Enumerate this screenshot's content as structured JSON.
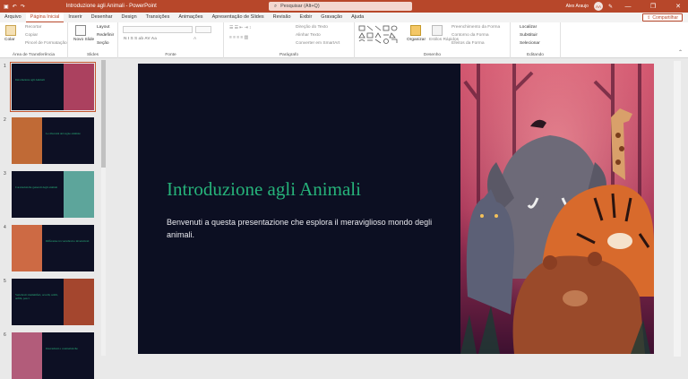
{
  "titlebar": {
    "title": "Introduzione agli Animali  -  PowerPoint",
    "search": "Pesquisar (Alt+Q)",
    "user": "Alex Araujo",
    "initials": "AA",
    "accent": "#b7472a"
  },
  "tabs": [
    "Arquivo",
    "Página Inicial",
    "Inserir",
    "Desenhar",
    "Design",
    "Transições",
    "Animações",
    "Apresentação de Slides",
    "Revisão",
    "Exibir",
    "Gravação",
    "Ajuda"
  ],
  "share_label": "Compartilhar",
  "ribbon": {
    "clipboard": {
      "label": "Área de Transferência",
      "paste": "Colar",
      "cut": "Recortar",
      "copy": "Copiar",
      "format": "Pincel de Formatação"
    },
    "slides": {
      "label": "Slides",
      "new_slide": "Novo Slide",
      "layout": "Layout",
      "reset": "Redefinir",
      "section": "Seção"
    },
    "font": {
      "label": "Fonte"
    },
    "paragraph": {
      "label": "Parágrafo",
      "dir": "Direção do Texto",
      "align": "Alinhar Texto",
      "smartart": "Converter em SmartArt"
    },
    "drawing": {
      "label": "Desenho",
      "arrange": "Organizar",
      "styles": "Estilos Rápidos",
      "fill": "Preenchimento da Forma",
      "outline": "Contorno da Forma",
      "effects": "Efeitos da Forma"
    },
    "editing": {
      "label": "Editando",
      "find": "Localizar",
      "replace": "Substituir",
      "select": "Selecionar"
    }
  },
  "thumbnails": [
    {
      "num": "1",
      "title": "Introduzione agli Animali"
    },
    {
      "num": "2",
      "title": "Le diversità del regno animale"
    },
    {
      "num": "3",
      "title": "Caratteristiche generali degli animali"
    },
    {
      "num": "4",
      "title": "Differenze tra vertebrati e invertebrati"
    },
    {
      "num": "5",
      "title": "Vertebrati: mammiferi, uccelli, rettili, anfibi, pesci"
    },
    {
      "num": "6",
      "title": "Invertebrati e caratteristiche"
    }
  ],
  "slide": {
    "title": "Introduzione agli Animali",
    "body": "Benvenuti a questa presentazione che esplora il meraviglioso mondo degli animali."
  }
}
